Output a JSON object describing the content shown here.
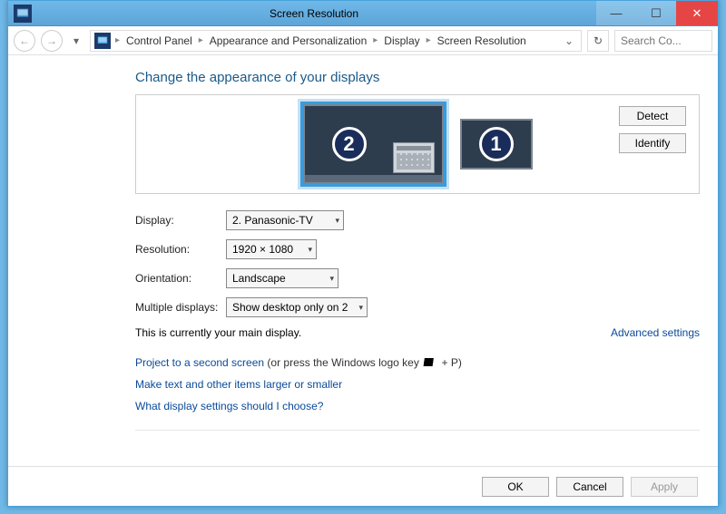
{
  "titlebar": {
    "title": "Screen Resolution"
  },
  "breadcrumb": {
    "items": [
      "Control Panel",
      "Appearance and Personalization",
      "Display",
      "Screen Resolution"
    ]
  },
  "search": {
    "placeholder": "Search Co..."
  },
  "page": {
    "heading": "Change the appearance of your displays"
  },
  "monitor_buttons": {
    "detect": "Detect",
    "identify": "Identify"
  },
  "monitors": {
    "primary_num": "2",
    "secondary_num": "1"
  },
  "form": {
    "display_label": "Display:",
    "display_value": "2. Panasonic-TV",
    "resolution_label": "Resolution:",
    "resolution_value": "1920 × 1080",
    "orientation_label": "Orientation:",
    "orientation_value": "Landscape",
    "multiple_label": "Multiple displays:",
    "multiple_value": "Show desktop only on 2"
  },
  "status": {
    "main_display_note": "This is currently your main display."
  },
  "links": {
    "advanced": "Advanced settings",
    "project": "Project to a second screen",
    "project_suffix_a": " (or press the Windows logo key ",
    "project_suffix_b": " + P)",
    "larger": "Make text and other items larger or smaller",
    "which": "What display settings should I choose?"
  },
  "footer": {
    "ok": "OK",
    "cancel": "Cancel",
    "apply": "Apply"
  }
}
